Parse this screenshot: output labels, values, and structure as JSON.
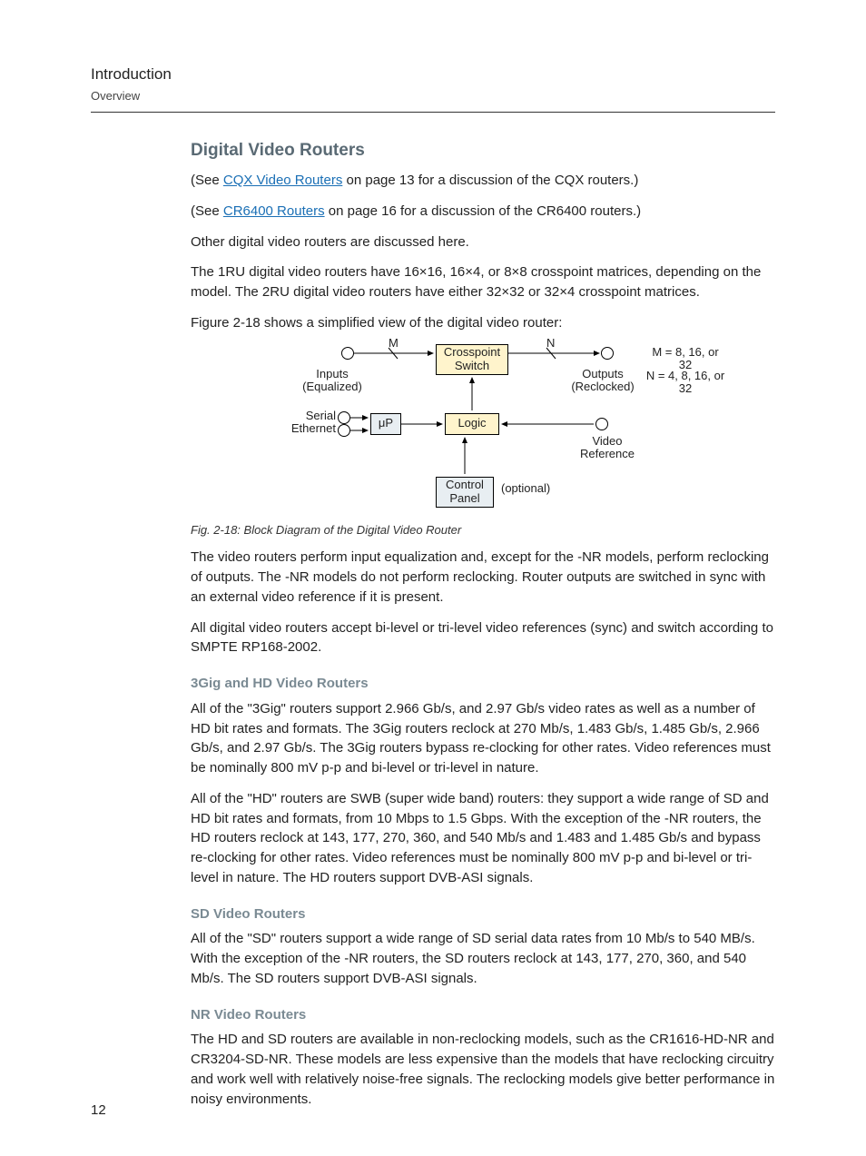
{
  "header": {
    "title": "Introduction",
    "subtitle": "Overview"
  },
  "page_number": "12",
  "h_digital": "Digital Video Routers",
  "p_see1a": "(See ",
  "link_cqx": "CQX Video Routers",
  "p_see1b": " on page 13 for a discussion of the CQX routers.)",
  "p_see2a": "(See ",
  "link_cr6400": "CR6400 Routers",
  "p_see2b": " on page 16 for a discussion of the CR6400 routers.)",
  "p_other": "Other digital video routers are discussed here.",
  "p_1ru": "The 1RU digital video routers have 16×16, 16×4, or 8×8 crosspoint matrices, depending on the model. The 2RU digital video routers have either 32×32 or 32×4 crosspoint matrices.",
  "p_figintro": "Figure 2-18 shows a simplified view of the digital video router:",
  "diagram": {
    "xp": "Crosspoint Switch",
    "logic": "Logic",
    "up": "μP",
    "cp": "Control Panel",
    "m": "M",
    "n": "N",
    "inputs": "Inputs (Equalized)",
    "outputs": "Outputs (Reclocked)",
    "serial": "Serial",
    "ethernet": "Ethernet",
    "vref": "Video Reference",
    "optional": "(optional)",
    "m_eq": "M = 8, 16, or 32",
    "n_eq": "N = 4, 8, 16, or 32"
  },
  "fig_caption": "Fig. 2-18: Block Diagram of the Digital Video Router",
  "p_perform": "The video routers perform input equalization and, except for the -NR models, perform reclocking of outputs. The -NR models do not perform reclocking. Router outputs are switched in sync with an external video reference if it is present.",
  "p_accept": "All digital video routers accept bi-level or tri-level video references (sync) and switch according to SMPTE RP168-2002.",
  "h_3gig": "3Gig and HD Video Routers",
  "p_3gig1": "All of the \"3Gig\" routers support 2.966 Gb/s, and 2.97 Gb/s video rates as well as a number of HD bit rates and formats. The 3Gig routers reclock at 270 Mb/s, 1.483 Gb/s, 1.485 Gb/s, 2.966 Gb/s, and 2.97 Gb/s. The 3Gig routers bypass re-clocking for other rates. Video references must be nominally 800 mV p-p and bi-level or tri-level in nature.",
  "p_3gig2": "All of the \"HD\" routers are SWB (super wide band) routers: they support a wide range of SD and HD bit rates and formats, from 10 Mbps to 1.5 Gbps. With the exception of the -NR routers, the HD routers reclock at 143, 177, 270, 360, and 540 Mb/s and 1.483 and 1.485 Gb/s and bypass re-clocking for other rates. Video references must be nominally 800 mV p-p and bi-level or tri-level in nature. The HD routers support DVB-ASI signals.",
  "h_sd": "SD Video Routers",
  "p_sd": "All of the \"SD\" routers support a wide range of SD serial data rates from 10 Mb/s to 540 MB/s. With the exception of the -NR routers, the SD routers reclock at 143, 177, 270, 360, and 540 Mb/s. The SD routers support DVB-ASI signals.",
  "h_nr": "NR Video Routers",
  "p_nr": "The HD and SD routers are available in non-reclocking models, such as the CR1616-HD-NR and CR3204-SD-NR. These models are less expensive than the models that have reclocking circuitry and work well with relatively noise-free signals. The reclocking models give better performance in noisy environments."
}
